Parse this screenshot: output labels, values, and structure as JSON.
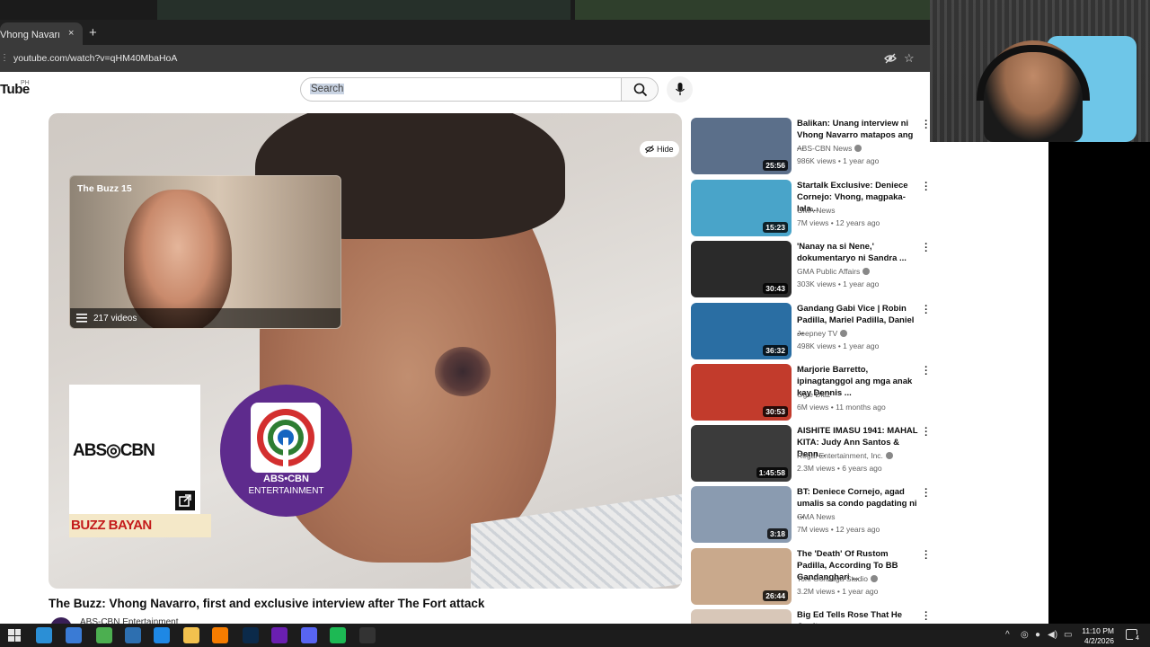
{
  "browser": {
    "tab_title": "Vhong Navarro, first",
    "tab_close": "×",
    "new_tab": "+",
    "url": "youtube.com/watch?v=qHM40MbaHoA"
  },
  "youtube": {
    "logo": "Tube",
    "region": "PH",
    "search_placeholder": "Search"
  },
  "video": {
    "hide_label": "Hide",
    "playlist_title": "The Buzz 15",
    "playlist_count": "217 videos",
    "brand_logo_text": "ABS◎CBN",
    "strip_text": "BUZZ BAYAN",
    "ent_name": "ABS•CBN",
    "ent_sub": "ENTERTAINMENT",
    "title": "The Buzz: Vhong Navarro, first and exclusive interview after The Fort attack",
    "channel": "ABS-CBN Entertainment"
  },
  "recommendations": [
    {
      "title": "Balikan: Unang interview ni Vhong Navarro matapos ang ...",
      "channel": "ABS-CBN News",
      "verified": true,
      "meta": "986K views • 1 year ago",
      "duration": "25:56",
      "thumb_color": "#5b6f8a"
    },
    {
      "title": "Startalk Exclusive: Deniece Cornejo: Vhong, magpaka-lala...",
      "channel": "GMA News",
      "verified": false,
      "meta": "7M views • 12 years ago",
      "duration": "15:23",
      "thumb_color": "#49a4c9"
    },
    {
      "title": "'Nanay na si Nene,' dokumentaryo ni Sandra ...",
      "channel": "GMA Public Affairs",
      "verified": true,
      "meta": "303K views • 1 year ago",
      "duration": "30:43",
      "thumb_color": "#2a2a2a"
    },
    {
      "title": "Gandang Gabi Vice | Robin Padilla, Mariel Padilla, Daniel ...",
      "channel": "Jeepney TV",
      "verified": true,
      "meta": "498K views • 1 year ago",
      "duration": "36:32",
      "thumb_color": "#2a6ea3"
    },
    {
      "title": "Marjorie Barretto, ipinagtanggol ang mga anak kay Dennis ...",
      "channel": "Ogie Diaz",
      "verified": false,
      "meta": "6M views • 11 months ago",
      "duration": "30:53",
      "thumb_color": "#c23b2c"
    },
    {
      "title": "AISHITE IMASU 1941: MAHAL KITA: Judy Ann Santos & Denn...",
      "channel": "Regal Entertainment, Inc.",
      "verified": true,
      "meta": "2.3M views • 6 years ago",
      "duration": "1:45:58",
      "thumb_color": "#3b3b3b"
    },
    {
      "title": "BT: Deniece Cornejo, agad umalis sa condo pagdating ni ...",
      "channel": "GMA News",
      "verified": false,
      "meta": "7M views • 12 years ago",
      "duration": "3:18",
      "thumb_color": "#8a9bb0"
    },
    {
      "title": "The 'Death' Of Rustom Padilla, According To BB Gandanghari ...",
      "channel": "Toni Gonzaga Studio",
      "verified": true,
      "meta": "3.2M views • 1 year ago",
      "duration": "26:44",
      "thumb_color": "#c9a98c"
    },
    {
      "title": "Big Ed Tells Rose That He Can't",
      "channel": "",
      "verified": false,
      "meta": "",
      "duration": "",
      "thumb_color": "#d8c7b8"
    }
  ],
  "taskbar": {
    "time": "11:10 PM",
    "date": "4/2/2026",
    "notif_count": "4",
    "apps": [
      {
        "name": "edge-icon",
        "color": "#2b8fd6"
      },
      {
        "name": "copilot-icon",
        "color": "#3a7bd5"
      },
      {
        "name": "chrome-icon",
        "color": "#4caf50"
      },
      {
        "name": "pen-icon",
        "color": "#2d6fb0"
      },
      {
        "name": "vscode-icon",
        "color": "#1e88e5"
      },
      {
        "name": "file-explorer-icon",
        "color": "#f2c14e"
      },
      {
        "name": "sublime-icon",
        "color": "#f57c00"
      },
      {
        "name": "photoshop-icon",
        "color": "#0b2a4a"
      },
      {
        "name": "yahoo-icon",
        "color": "#6a1fb0"
      },
      {
        "name": "discord-icon",
        "color": "#5865f2"
      },
      {
        "name": "spotify-icon",
        "color": "#1db954"
      },
      {
        "name": "obs-icon",
        "color": "#333333"
      }
    ]
  }
}
